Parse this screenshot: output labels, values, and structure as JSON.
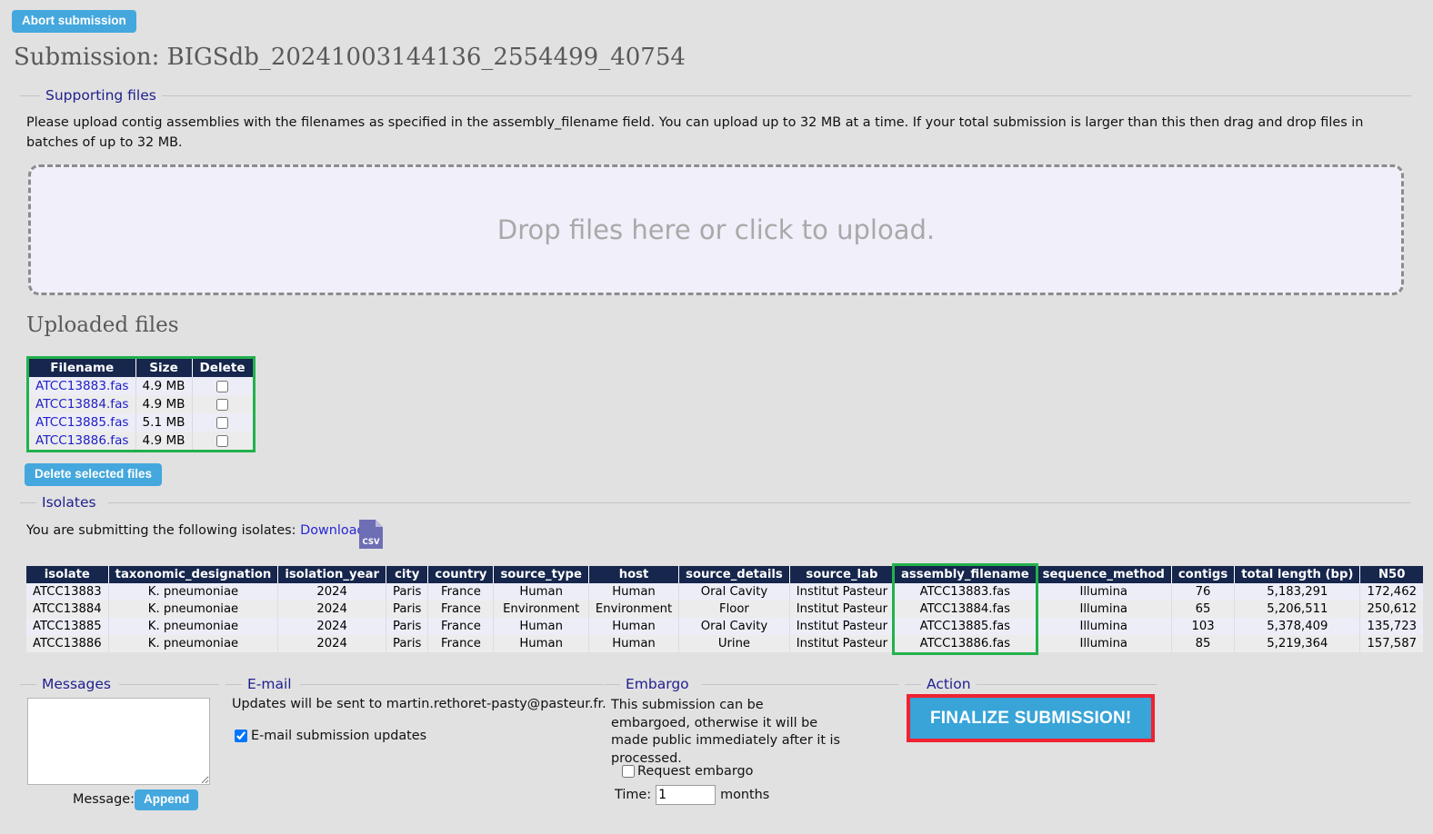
{
  "header": {
    "abort_label": "Abort submission",
    "title": "Submission: BIGSdb_20241003144136_2554499_40754"
  },
  "supporting_files": {
    "legend": "Supporting files",
    "instructions": "Please upload contig assemblies with the filenames as specified in the assembly_filename field. You can upload up to 32 MB at a time. If your total submission is larger than this then drag and drop files in batches of up to 32 MB.",
    "dropzone_text": "Drop files here or click to upload."
  },
  "uploaded_files": {
    "heading": "Uploaded files",
    "columns": [
      "Filename",
      "Size",
      "Delete"
    ],
    "rows": [
      {
        "filename": "ATCC13883.fas",
        "size": "4.9 MB",
        "delete": false
      },
      {
        "filename": "ATCC13884.fas",
        "size": "4.9 MB",
        "delete": false
      },
      {
        "filename": "ATCC13885.fas",
        "size": "5.1 MB",
        "delete": false
      },
      {
        "filename": "ATCC13886.fas",
        "size": "4.9 MB",
        "delete": false
      }
    ],
    "delete_button": "Delete selected files",
    "highlight_color": "#22b14c"
  },
  "isolates": {
    "legend": "Isolates",
    "intro": "You are submitting the following isolates:",
    "download_label": "Download",
    "csv_icon_label": "CSV",
    "columns": [
      "isolate",
      "taxonomic_designation",
      "isolation_year",
      "city",
      "country",
      "source_type",
      "host",
      "source_details",
      "source_lab",
      "assembly_filename",
      "sequence_method",
      "contigs",
      "total length (bp)",
      "N50"
    ],
    "rows": [
      [
        "ATCC13883",
        "K. pneumoniae",
        "2024",
        "Paris",
        "France",
        "Human",
        "Human",
        "Oral Cavity",
        "Institut Pasteur",
        "ATCC13883.fas",
        "Illumina",
        "76",
        "5,183,291",
        "172,462"
      ],
      [
        "ATCC13884",
        "K. pneumoniae",
        "2024",
        "Paris",
        "France",
        "Environment",
        "Environment",
        "Floor",
        "Institut Pasteur",
        "ATCC13884.fas",
        "Illumina",
        "65",
        "5,206,511",
        "250,612"
      ],
      [
        "ATCC13885",
        "K. pneumoniae",
        "2024",
        "Paris",
        "France",
        "Human",
        "Human",
        "Oral Cavity",
        "Institut Pasteur",
        "ATCC13885.fas",
        "Illumina",
        "103",
        "5,378,409",
        "135,723"
      ],
      [
        "ATCC13886",
        "K. pneumoniae",
        "2024",
        "Paris",
        "France",
        "Human",
        "Human",
        "Urine",
        "Institut Pasteur",
        "ATCC13886.fas",
        "Illumina",
        "85",
        "5,219,364",
        "157,587"
      ]
    ],
    "highlight_column": "assembly_filename",
    "highlight_color": "#22b14c"
  },
  "messages": {
    "legend": "Messages",
    "textarea_value": "",
    "message_label": "Message:",
    "append_label": "Append"
  },
  "email": {
    "legend": "E-mail",
    "notice": "Updates will be sent to martin.rethoret-pasty@pasteur.fr.",
    "checkbox_label": "E-mail submission updates",
    "checkbox_checked": true
  },
  "embargo": {
    "legend": "Embargo",
    "notice": "This submission can be embargoed, otherwise it will be made public immediately after it is processed.",
    "checkbox_label": "Request embargo",
    "checkbox_checked": false,
    "time_label": "Time:",
    "time_value": "1",
    "time_unit": "months"
  },
  "action": {
    "legend": "Action",
    "finalize_label": "FINALIZE SUBMISSION!",
    "highlight_color": "#ef2231"
  }
}
